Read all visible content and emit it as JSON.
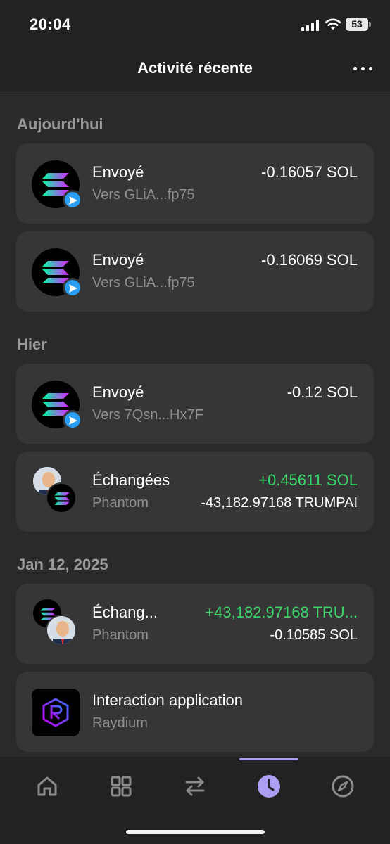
{
  "status_bar": {
    "time": "20:04",
    "battery": "53"
  },
  "header": {
    "title": "Activité récente"
  },
  "sections": [
    {
      "label": "Aujourd'hui"
    },
    {
      "label": "Hier"
    },
    {
      "label": "Jan 12, 2025"
    }
  ],
  "transactions": [
    {
      "title": "Envoyé",
      "subtitle": "Vers GLiA...fp75",
      "amount": "-0.16057 SOL",
      "amount_color": "#ffffff"
    },
    {
      "title": "Envoyé",
      "subtitle": "Vers GLiA...fp75",
      "amount": "-0.16069 SOL",
      "amount_color": "#ffffff"
    },
    {
      "title": "Envoyé",
      "subtitle": "Vers 7Qsn...Hx7F",
      "amount": "-0.12 SOL",
      "amount_color": "#ffffff"
    },
    {
      "title": "Échangées",
      "subtitle": "Phantom",
      "amount": "+0.45611 SOL",
      "amount_color": "#3dd36b",
      "amount2": "-43,182.97168 TRUMPAI"
    },
    {
      "title": "Échang...",
      "subtitle": "Phantom",
      "amount": "+43,182.97168 TRU...",
      "amount_color": "#3dd36b",
      "amount2": "-0.10585 SOL"
    },
    {
      "title": "Interaction application",
      "subtitle": "Raydium"
    }
  ],
  "colors": {
    "positive": "#3dd36b",
    "accent": "#ab9ff2",
    "send_badge": "#2a9df4"
  },
  "tabs": [
    {
      "icon": "home-icon"
    },
    {
      "icon": "grid-icon"
    },
    {
      "icon": "swap-icon"
    },
    {
      "icon": "clock-icon",
      "active": true
    },
    {
      "icon": "compass-icon"
    }
  ]
}
